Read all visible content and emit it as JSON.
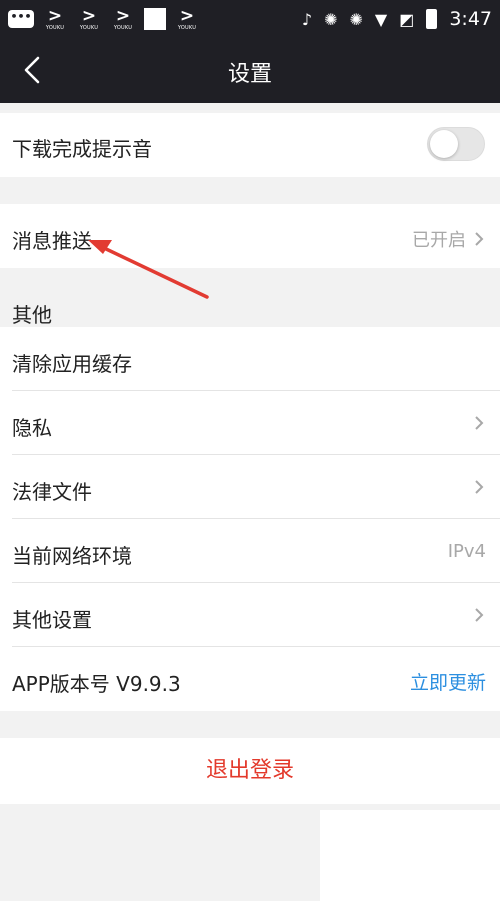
{
  "status_bar": {
    "apps": [
      {
        "name": "youku",
        "label": "YOUKU"
      },
      {
        "name": "youku",
        "label": "YOUKU"
      },
      {
        "name": "youku",
        "label": "YOUKU"
      },
      {
        "name": "youku",
        "label": "YOUKU"
      }
    ],
    "chat_glyph": "•••",
    "time": "3:47"
  },
  "nav": {
    "title": "设置"
  },
  "download_row": {
    "label": "下载完成提示音",
    "toggle_on": false
  },
  "push_row": {
    "label": "消息推送",
    "value": "已开启"
  },
  "other_section": {
    "header": "其他",
    "items": [
      {
        "label": "清除应用缓存",
        "value": "",
        "chevron": false
      },
      {
        "label": "隐私",
        "value": "",
        "chevron": true
      },
      {
        "label": "法律文件",
        "value": "",
        "chevron": true
      },
      {
        "label": "当前网络环境",
        "value": "IPv4",
        "chevron": false
      },
      {
        "label": "其他设置",
        "value": "",
        "chevron": true
      }
    ],
    "version": {
      "label": "APP版本号 V9.9.3",
      "action": "立即更新"
    }
  },
  "logout": {
    "label": "退出登录"
  },
  "colors": {
    "header_bg": "#1f1f25",
    "accent_blue": "#2c8fe0",
    "logout_red": "#e3392b",
    "annotation_red": "#e23b32"
  }
}
